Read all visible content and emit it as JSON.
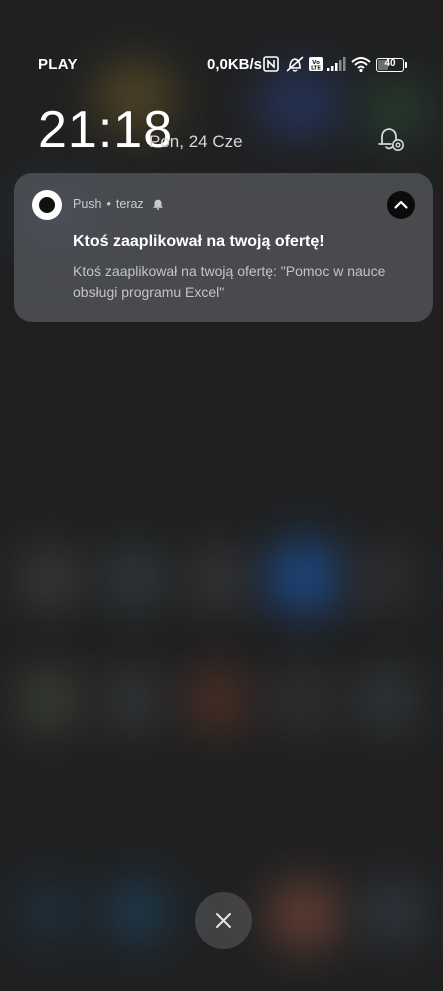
{
  "status_bar": {
    "carrier": "PLAY",
    "net_speed": "0,0KB/s",
    "icons": [
      "nfc-icon",
      "alarm-off-icon",
      "volte-icon",
      "signal-icon",
      "wifi-icon",
      "battery-icon"
    ],
    "battery_level": "40",
    "battery_fraction": 0.4
  },
  "lockscreen": {
    "time": "21:18",
    "date": "Pon, 24 Cze",
    "settings_icon": "notification-settings-icon"
  },
  "notification": {
    "app_name": "Push",
    "separator": "•",
    "time_ago": "teraz",
    "title": "Ktoś zaaplikował na twoją ofertę!",
    "body": "Ktoś zaaplikował na twoją ofertę: \"Pomoc w nauce obsługi programu Excel\"",
    "app_icon": "push-app-icon",
    "bell_icon": "bell-icon",
    "collapse_icon": "chevron-up-icon"
  },
  "actions": {
    "clear_icon": "close-icon"
  },
  "colors": {
    "background": "#222324",
    "card": "#585a5e",
    "text_primary": "#ffffff",
    "text_secondary": "#c4c4c6"
  }
}
